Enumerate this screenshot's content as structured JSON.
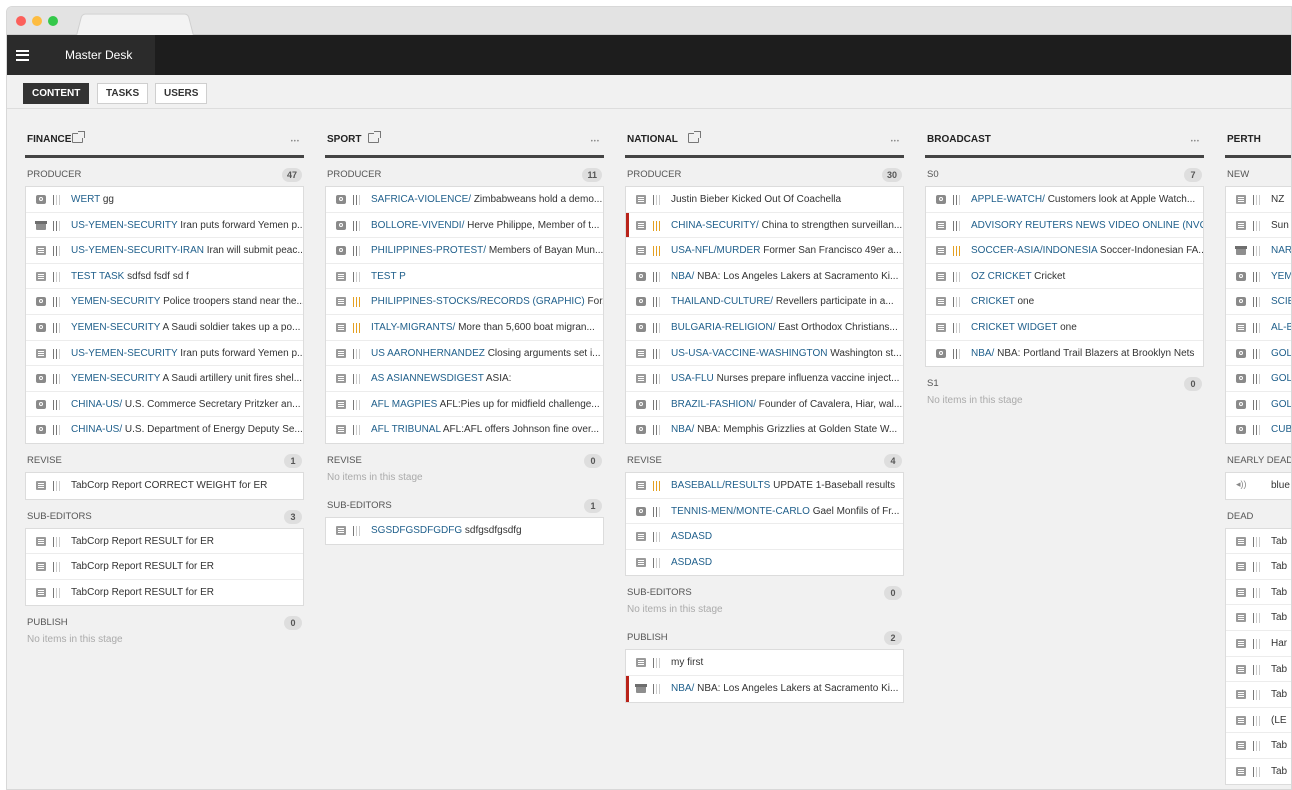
{
  "app": {
    "title": "Master Desk"
  },
  "nav": {
    "content": "CONTENT",
    "tasks": "TASKS",
    "users": "USERS"
  },
  "columns": [
    {
      "title": "FINANCE",
      "stages": [
        {
          "name": "PRODUCER",
          "count": "47",
          "items": [
            {
              "icon": "photo",
              "urgency": 1,
              "slug": "WERT",
              "headline": "gg"
            },
            {
              "icon": "pkg",
              "urgency": 2,
              "slug": "US-YEMEN-SECURITY",
              "headline": "Iran puts forward Yemen p..."
            },
            {
              "icon": "text",
              "urgency": 2,
              "slug": "US-YEMEN-SECURITY-IRAN",
              "headline": "Iran will submit peac..."
            },
            {
              "icon": "text",
              "urgency": 1,
              "slug": "TEST TASK",
              "headline": "sdfsd fsdf sd f"
            },
            {
              "icon": "photo",
              "urgency": 2,
              "slug": "YEMEN-SECURITY",
              "headline": "Police troopers stand near the..."
            },
            {
              "icon": "photo",
              "urgency": 2,
              "slug": "YEMEN-SECURITY",
              "headline": "A Saudi soldier takes up a po..."
            },
            {
              "icon": "text",
              "urgency": 2,
              "slug": "US-YEMEN-SECURITY",
              "headline": "Iran puts forward Yemen p..."
            },
            {
              "icon": "photo",
              "urgency": 2,
              "slug": "YEMEN-SECURITY",
              "headline": "A Saudi artillery unit fires shel..."
            },
            {
              "icon": "photo",
              "urgency": 2,
              "slug": "CHINA-US/",
              "headline": "U.S. Commerce Secretary Pritzker an..."
            },
            {
              "icon": "photo",
              "urgency": 2,
              "slug": "CHINA-US/",
              "headline": "U.S. Department of Energy Deputy Se..."
            }
          ]
        },
        {
          "name": "REVISE",
          "count": "1",
          "items": [
            {
              "icon": "text",
              "urgency": 1,
              "slug": "",
              "headline": "TabCorp Report CORRECT WEIGHT for ER"
            }
          ]
        },
        {
          "name": "SUB-EDITORS",
          "count": "3",
          "items": [
            {
              "icon": "text",
              "urgency": 1,
              "slug": "",
              "headline": "TabCorp Report RESULT for ER"
            },
            {
              "icon": "text",
              "urgency": 1,
              "slug": "",
              "headline": "TabCorp Report RESULT for ER"
            },
            {
              "icon": "text",
              "urgency": 1,
              "slug": "",
              "headline": "TabCorp Report RESULT for ER"
            }
          ]
        },
        {
          "name": "PUBLISH",
          "count": "0",
          "empty": "No items in this stage",
          "items": []
        }
      ]
    },
    {
      "title": "SPORT",
      "stages": [
        {
          "name": "PRODUCER",
          "count": "11",
          "items": [
            {
              "icon": "photo",
              "urgency": 2,
              "slug": "SAFRICA-VIOLENCE/",
              "headline": "Zimbabweans hold a demo..."
            },
            {
              "icon": "photo",
              "urgency": 2,
              "slug": "BOLLORE-VIVENDI/",
              "headline": "Herve Philippe, Member of t..."
            },
            {
              "icon": "photo",
              "urgency": 2,
              "slug": "PHILIPPINES-PROTEST/",
              "headline": "Members of Bayan Mun..."
            },
            {
              "icon": "text",
              "urgency": 1,
              "slug": "TEST P",
              "headline": ""
            },
            {
              "icon": "text",
              "urgency": 3,
              "slug": "PHILIPPINES-STOCKS/RECORDS (GRAPHIC)",
              "headline": "For..."
            },
            {
              "icon": "text",
              "urgency": 3,
              "slug": "ITALY-MIGRANTS/",
              "headline": "More than 5,600 boat migran..."
            },
            {
              "icon": "text",
              "urgency": 1,
              "slug": "US AARONHERNANDEZ",
              "headline": "Closing arguments set i..."
            },
            {
              "icon": "text",
              "urgency": 1,
              "slug": "AS ASIANNEWSDIGEST",
              "headline": "ASIA:"
            },
            {
              "icon": "text",
              "urgency": 1,
              "slug": "AFL MAGPIES",
              "headline": "AFL:Pies up for midfield challenge..."
            },
            {
              "icon": "text",
              "urgency": 1,
              "slug": "AFL TRIBUNAL",
              "headline": "AFL:AFL offers Johnson fine over..."
            }
          ]
        },
        {
          "name": "REVISE",
          "count": "0",
          "empty": "No items in this stage",
          "items": []
        },
        {
          "name": "SUB-EDITORS",
          "count": "1",
          "items": [
            {
              "icon": "text",
              "urgency": 1,
              "slug": "SGSDFGSDFGDFG",
              "headline": "sdfgsdfgsdfg"
            }
          ]
        }
      ]
    },
    {
      "title": "NATIONAL",
      "stages": [
        {
          "name": "PRODUCER",
          "count": "30",
          "items": [
            {
              "icon": "text",
              "urgency": 1,
              "slug": "",
              "headline": "Justin Bieber Kicked Out Of Coachella"
            },
            {
              "icon": "text",
              "urgency": 3,
              "flag": true,
              "slug": "CHINA-SECURITY/",
              "headline": "China to strengthen surveillan..."
            },
            {
              "icon": "text",
              "urgency": 3,
              "slug": "USA-NFL/MURDER",
              "headline": "Former San Francisco 49er a..."
            },
            {
              "icon": "photo",
              "urgency": 2,
              "slug": "NBA/",
              "headline": "NBA: Los Angeles Lakers at Sacramento Ki..."
            },
            {
              "icon": "photo",
              "urgency": 2,
              "slug": "THAILAND-CULTURE/",
              "headline": "Revellers participate in a..."
            },
            {
              "icon": "photo",
              "urgency": 2,
              "slug": "BULGARIA-RELIGION/",
              "headline": "East Orthodox Christians..."
            },
            {
              "icon": "text",
              "urgency": 2,
              "slug": "US-USA-VACCINE-WASHINGTON",
              "headline": "Washington st..."
            },
            {
              "icon": "text",
              "urgency": 2,
              "slug": "USA-FLU",
              "headline": "Nurses prepare influenza vaccine inject..."
            },
            {
              "icon": "photo",
              "urgency": 2,
              "slug": "BRAZIL-FASHION/",
              "headline": "Founder of Cavalera, Hiar, wal..."
            },
            {
              "icon": "photo",
              "urgency": 2,
              "slug": "NBA/",
              "headline": "NBA: Memphis Grizzlies at Golden State W..."
            }
          ]
        },
        {
          "name": "REVISE",
          "count": "4",
          "items": [
            {
              "icon": "text",
              "urgency": 3,
              "slug": "BASEBALL/RESULTS",
              "headline": "UPDATE 1-Baseball results"
            },
            {
              "icon": "photo",
              "urgency": 2,
              "slug": "TENNIS-MEN/MONTE-CARLO",
              "headline": "Gael Monfils of Fr..."
            },
            {
              "icon": "text",
              "urgency": 1,
              "slug": "ASDASD",
              "headline": ""
            },
            {
              "icon": "text",
              "urgency": 1,
              "slug": "ASDASD",
              "headline": ""
            }
          ]
        },
        {
          "name": "SUB-EDITORS",
          "count": "0",
          "empty": "No items in this stage",
          "items": []
        },
        {
          "name": "PUBLISH",
          "count": "2",
          "items": [
            {
              "icon": "text",
              "urgency": 1,
              "slug": "",
              "headline": "my first"
            },
            {
              "icon": "pkg",
              "urgency": 1,
              "flag": true,
              "slug": "NBA/",
              "headline": "NBA: Los Angeles Lakers at Sacramento Ki..."
            }
          ]
        }
      ]
    },
    {
      "title": "BROADCAST",
      "stages": [
        {
          "name": "S0",
          "count": "7",
          "items": [
            {
              "icon": "photo",
              "urgency": 2,
              "slug": "APPLE-WATCH/",
              "headline": "Customers look at Apple Watch..."
            },
            {
              "icon": "text",
              "urgency": 2,
              "slug": "ADVISORY REUTERS NEWS VIDEO ONLINE (NVO...",
              "headline": ""
            },
            {
              "icon": "text",
              "urgency": 3,
              "slug": "SOCCER-ASIA/INDONESIA",
              "headline": "Soccer-Indonesian FA..."
            },
            {
              "icon": "text",
              "urgency": 1,
              "slug": "OZ CRICKET",
              "headline": "Cricket"
            },
            {
              "icon": "text",
              "urgency": 1,
              "slug": "CRICKET",
              "headline": "one"
            },
            {
              "icon": "text",
              "urgency": 1,
              "slug": "CRICKET WIDGET",
              "headline": "one"
            },
            {
              "icon": "photo",
              "urgency": 2,
              "slug": "NBA/",
              "headline": "NBA: Portland Trail Blazers at Brooklyn Nets"
            }
          ]
        },
        {
          "name": "S1",
          "count": "0",
          "empty": "No items in this stage",
          "items": []
        }
      ]
    },
    {
      "title": "PERTH",
      "stages": [
        {
          "name": "NEW",
          "count": "",
          "items": [
            {
              "icon": "text",
              "urgency": 1,
              "slug": "",
              "headline": "NZ"
            },
            {
              "icon": "text",
              "urgency": 1,
              "slug": "",
              "headline": "Sun"
            },
            {
              "icon": "pkg",
              "urgency": 1,
              "slug": "NAR",
              "headline": ""
            },
            {
              "icon": "photo",
              "urgency": 2,
              "slug": "YEM",
              "headline": ""
            },
            {
              "icon": "photo",
              "urgency": 2,
              "slug": "SCIE",
              "headline": ""
            },
            {
              "icon": "text",
              "urgency": 2,
              "slug": "AL-B",
              "headline": ""
            },
            {
              "icon": "photo",
              "urgency": 2,
              "slug": "GOL",
              "headline": ""
            },
            {
              "icon": "photo",
              "urgency": 2,
              "slug": "GOL",
              "headline": ""
            },
            {
              "icon": "photo",
              "urgency": 2,
              "slug": "GOL",
              "headline": ""
            },
            {
              "icon": "photo",
              "urgency": 2,
              "slug": "CUB",
              "headline": ""
            }
          ]
        },
        {
          "name": "NEARLY DEAD",
          "count": "",
          "items": [
            {
              "icon": "audio",
              "urgency": 0,
              "slug": "",
              "headline": "blue"
            }
          ]
        },
        {
          "name": "DEAD",
          "count": "",
          "items": [
            {
              "icon": "text",
              "urgency": 1,
              "slug": "",
              "headline": "Tab"
            },
            {
              "icon": "text",
              "urgency": 1,
              "slug": "",
              "headline": "Tab"
            },
            {
              "icon": "text",
              "urgency": 1,
              "slug": "",
              "headline": "Tab"
            },
            {
              "icon": "text",
              "urgency": 1,
              "slug": "",
              "headline": "Tab"
            },
            {
              "icon": "text",
              "urgency": 1,
              "slug": "",
              "headline": "Har"
            },
            {
              "icon": "text",
              "urgency": 1,
              "slug": "",
              "headline": "Tab"
            },
            {
              "icon": "text",
              "urgency": 1,
              "slug": "",
              "headline": "Tab"
            },
            {
              "icon": "text",
              "urgency": 1,
              "slug": "",
              "headline": "(LE"
            },
            {
              "icon": "text",
              "urgency": 1,
              "slug": "",
              "headline": "Tab"
            },
            {
              "icon": "text",
              "urgency": 1,
              "slug": "",
              "headline": "Tab"
            }
          ]
        }
      ]
    }
  ]
}
